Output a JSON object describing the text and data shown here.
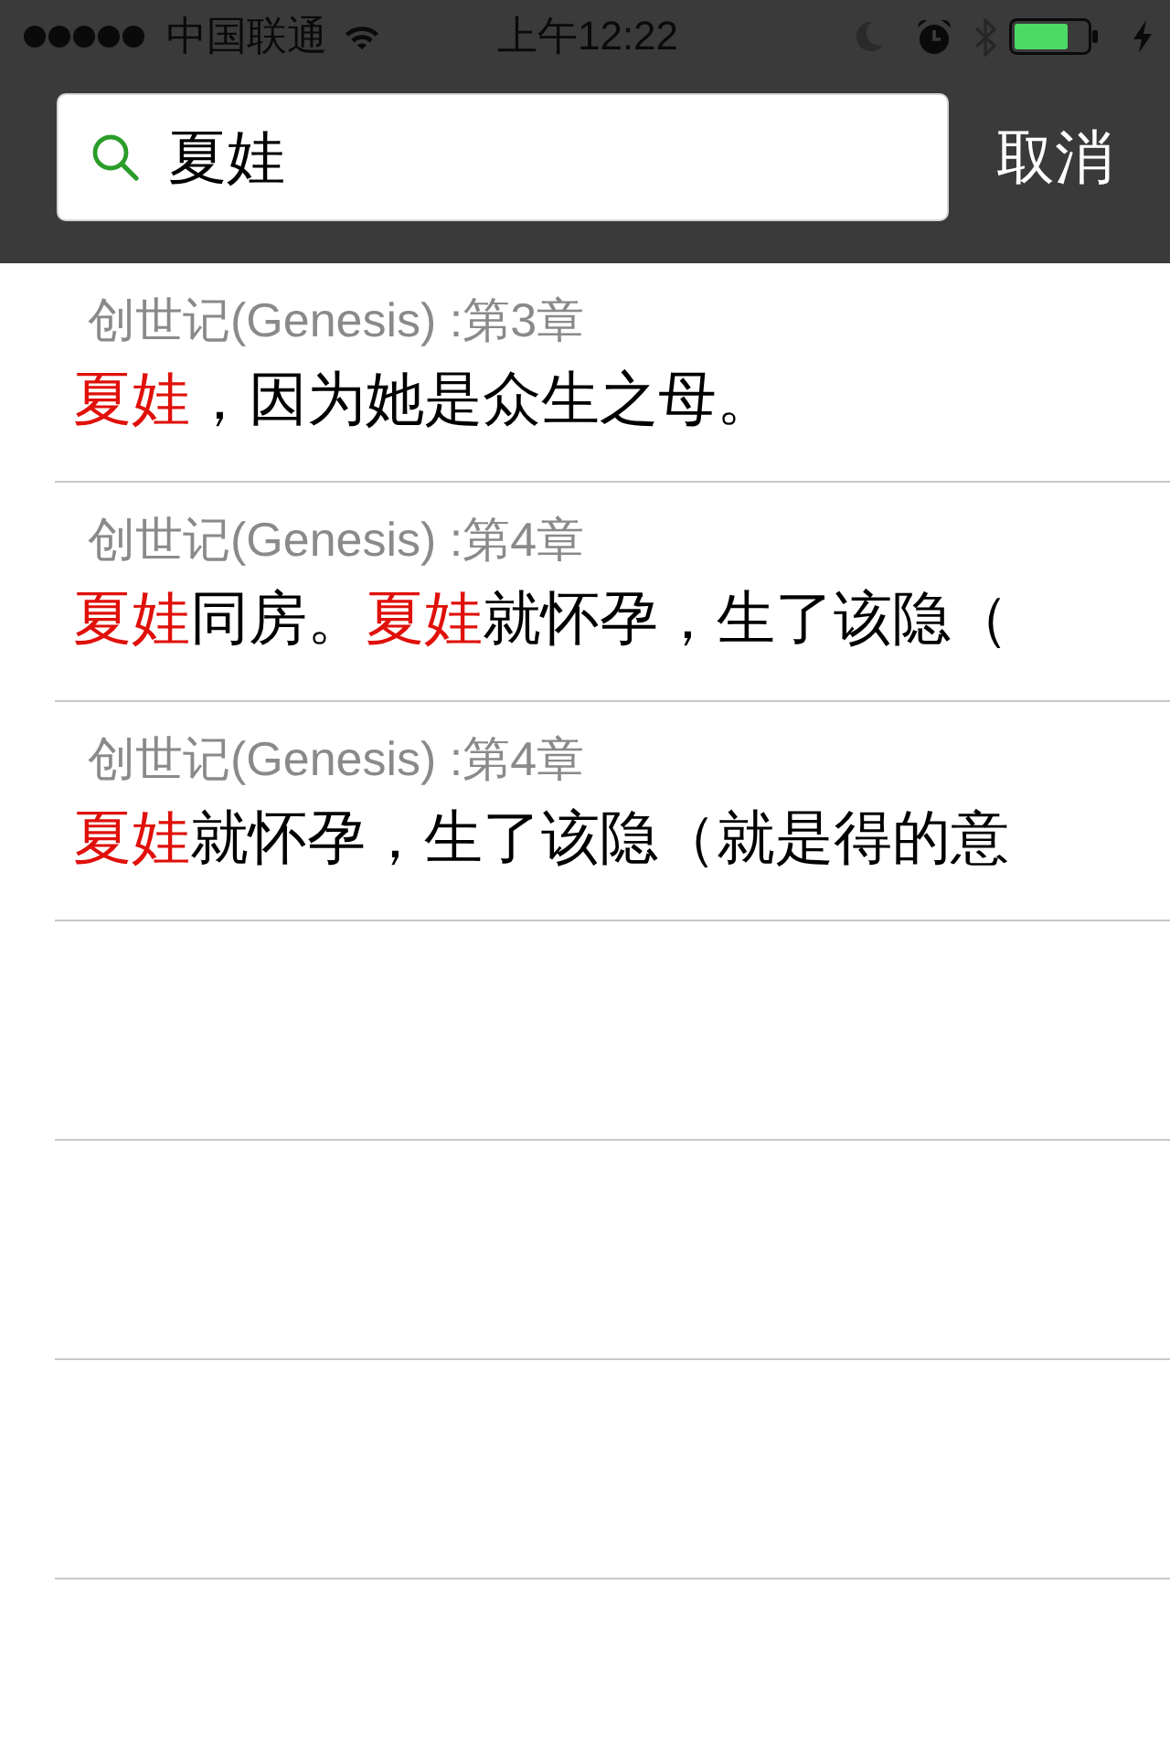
{
  "status_bar": {
    "carrier": "中国联通",
    "time": "上午12:22"
  },
  "search": {
    "value": "夏娃",
    "cancel": "取消"
  },
  "results": [
    {
      "reference": "创世记(Genesis) :第3章",
      "segments": [
        {
          "text": "夏娃",
          "highlighted": true
        },
        {
          "text": "，因为她是众生之母。",
          "highlighted": false
        }
      ]
    },
    {
      "reference": "创世记(Genesis) :第4章",
      "segments": [
        {
          "text": "夏娃",
          "highlighted": true
        },
        {
          "text": "同房。",
          "highlighted": false
        },
        {
          "text": "夏娃",
          "highlighted": true
        },
        {
          "text": "就怀孕，生了该隐（",
          "highlighted": false
        }
      ]
    },
    {
      "reference": "创世记(Genesis) :第4章",
      "segments": [
        {
          "text": "夏娃",
          "highlighted": true
        },
        {
          "text": "就怀孕，生了该隐（就是得的意",
          "highlighted": false
        }
      ]
    }
  ]
}
